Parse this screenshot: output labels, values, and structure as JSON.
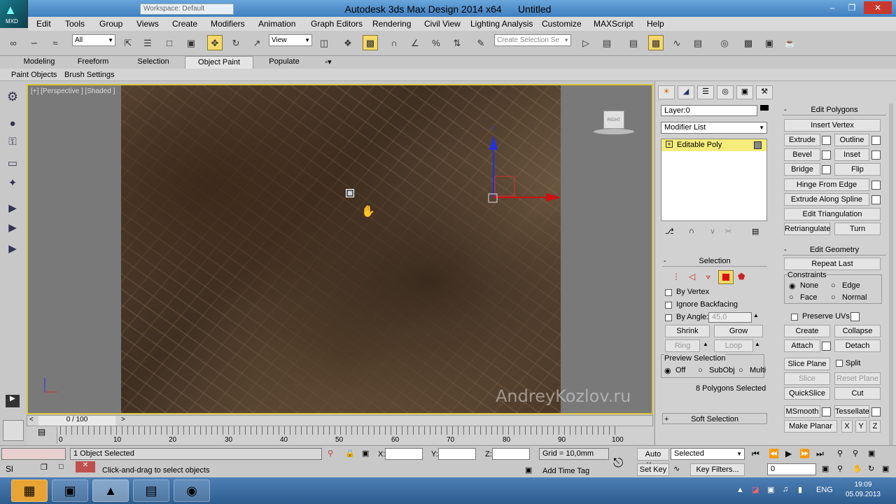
{
  "title": {
    "app": "Autodesk 3ds Max Design 2014 x64",
    "doc": "Untitled",
    "workspace": "Workspace: Default",
    "logo": "MXD"
  },
  "menu": [
    "Edit",
    "Tools",
    "Group",
    "Views",
    "Create",
    "Modifiers",
    "Animation",
    "Graph Editors",
    "Rendering",
    "Civil View",
    "Lighting Analysis",
    "Customize",
    "MAXScript",
    "Help"
  ],
  "toolbar": {
    "filter": "All",
    "refcoord": "View",
    "named_sel_placeholder": "Create Selection Se"
  },
  "ribbon": {
    "tabs": [
      "Modeling",
      "Freeform",
      "Selection",
      "Object Paint",
      "Populate"
    ],
    "active": "Object Paint",
    "subtabs": [
      "Paint Objects",
      "Brush Settings"
    ]
  },
  "viewport": {
    "label": "[+] [Perspective ] [Shaded ]",
    "watermark": "AndreyKozlov.ru",
    "viewcube": "RIGHT"
  },
  "timeslider": {
    "frame": "0 / 100",
    "ticks": [
      "0",
      "10",
      "20",
      "30",
      "40",
      "50",
      "60",
      "70",
      "80",
      "90",
      "100"
    ]
  },
  "status": {
    "selected": "1 Object Selected",
    "prompt": "Click-and-drag to select objects",
    "grid": "Grid = 10,0mm",
    "add_time_tag": "Add Time Tag",
    "auto_key": "Auto Key",
    "set_key": "Set Key",
    "key_mode": "Selected",
    "key_filters": "Key Filters...",
    "frame": "0",
    "x": "X:",
    "y": "Y:",
    "z": "Z:",
    "maxscript": "Sl"
  },
  "panel": {
    "layer": "Layer:0",
    "modifier_list": "Modifier List",
    "stack_item": "Editable Poly",
    "edit_polygons": {
      "title": "Edit Polygons",
      "insert_vertex": "Insert Vertex",
      "extrude": "Extrude",
      "outline": "Outline",
      "bevel": "Bevel",
      "inset": "Inset",
      "bridge": "Bridge",
      "flip": "Flip",
      "hinge": "Hinge From Edge",
      "extrude_spline": "Extrude Along Spline",
      "edit_tri": "Edit Triangulation",
      "retriangulate": "Retriangulate",
      "turn": "Turn"
    },
    "edit_geometry": {
      "title": "Edit Geometry",
      "repeat_last": "Repeat Last",
      "constraints": "Constraints",
      "none": "None",
      "edge": "Edge",
      "face": "Face",
      "normal": "Normal",
      "preserve_uvs": "Preserve UVs",
      "create": "Create",
      "collapse": "Collapse",
      "attach": "Attach",
      "detach": "Detach",
      "slice_plane": "Slice Plane",
      "split": "Split",
      "slice": "Slice",
      "reset_plane": "Reset Plane",
      "quickslice": "QuickSlice",
      "cut": "Cut",
      "msmooth": "MSmooth",
      "tessellate": "Tessellate",
      "make_planar": "Make Planar",
      "x": "X",
      "y": "Y",
      "z": "Z"
    },
    "selection": {
      "title": "Selection",
      "by_vertex": "By Vertex",
      "ignore_backfacing": "Ignore Backfacing",
      "by_angle": "By Angle:",
      "angle": "45,0",
      "shrink": "Shrink",
      "grow": "Grow",
      "ring": "Ring",
      "loop": "Loop",
      "preview": "Preview Selection",
      "off": "Off",
      "subobj": "SubObj",
      "multi": "Multi",
      "count": "8 Polygons Selected"
    },
    "soft_selection": "Soft Selection"
  },
  "taskbar": {
    "lang": "ENG",
    "time": "19:09",
    "date": "05.09.2013"
  }
}
